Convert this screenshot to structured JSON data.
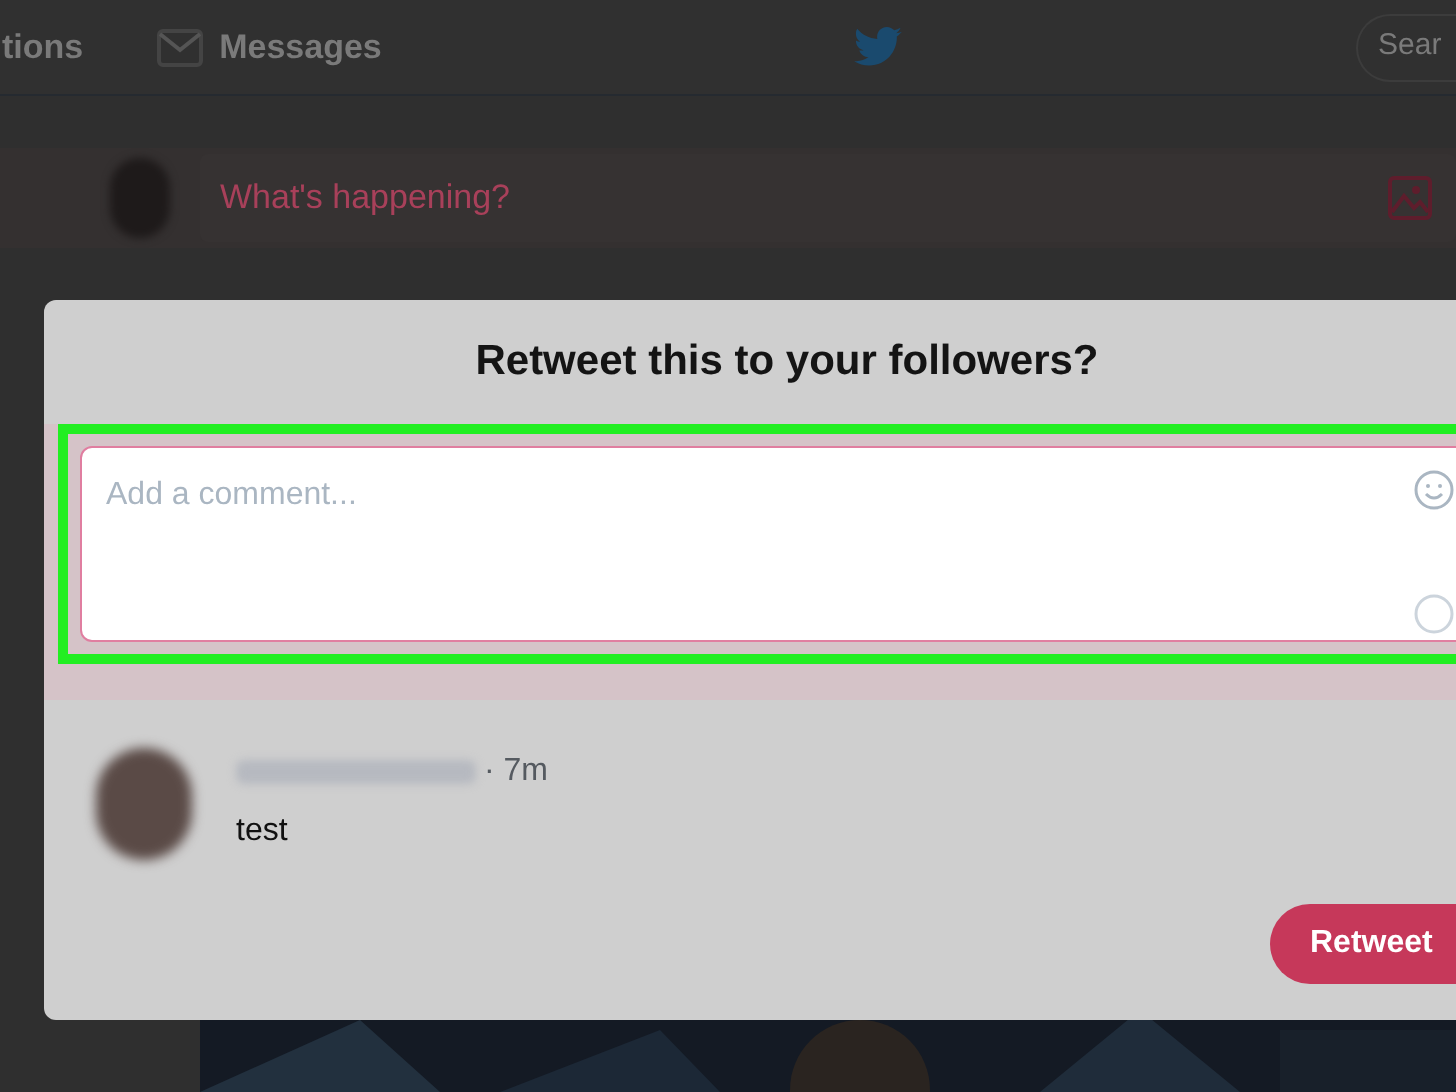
{
  "nav": {
    "items": [
      {
        "label": "tions"
      },
      {
        "label": "Messages"
      }
    ],
    "search": {
      "placeholder": "Sear"
    }
  },
  "compose": {
    "placeholder": "What's happening?"
  },
  "dialog": {
    "title": "Retweet this to your followers?",
    "comment": {
      "placeholder": "Add a comment...",
      "highlighted": true
    },
    "tweet": {
      "time": "· 7m",
      "text": "test"
    },
    "button": "Retweet"
  }
}
